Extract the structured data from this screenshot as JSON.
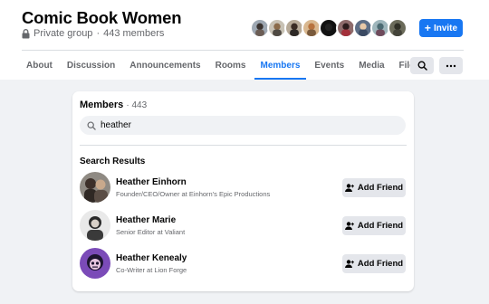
{
  "group": {
    "name": "Comic Book Women",
    "privacy": "Private group",
    "separator": "·",
    "members_count_text": "443 members"
  },
  "header_avatars": [
    "member-avatar-1",
    "member-avatar-2",
    "member-avatar-3",
    "member-avatar-4",
    "member-avatar-5",
    "member-avatar-6",
    "member-avatar-7",
    "member-avatar-8",
    "member-avatar-9"
  ],
  "invite": {
    "icon": "plus-icon",
    "label": "Invite"
  },
  "tabs": [
    {
      "label": "About",
      "active": false
    },
    {
      "label": "Discussion",
      "active": false
    },
    {
      "label": "Announcements",
      "active": false
    },
    {
      "label": "Rooms",
      "active": false
    },
    {
      "label": "Members",
      "active": true
    },
    {
      "label": "Events",
      "active": false
    },
    {
      "label": "Media",
      "active": false
    },
    {
      "label": "Files",
      "active": false
    }
  ],
  "toolbar": {
    "search_icon": "search-icon",
    "more_icon": "more-icon"
  },
  "members_panel": {
    "title": "Members",
    "count": "443",
    "search_value": "heather",
    "results_label": "Search Results",
    "results": [
      {
        "name": "Heather Einhorn",
        "role": "Founder/CEO/Owner at Einhorn's Epic Productions",
        "button": "Add Friend"
      },
      {
        "name": "Heather Marie",
        "role": "Senior Editor at Valiant",
        "button": "Add Friend"
      },
      {
        "name": "Heather Kenealy",
        "role": "Co-Writer at Lion Forge",
        "button": "Add Friend"
      }
    ]
  },
  "colors": {
    "accent": "#1877f2",
    "background": "#f0f2f5",
    "button_gray": "#e4e6eb",
    "secondary_text": "#65676b"
  }
}
